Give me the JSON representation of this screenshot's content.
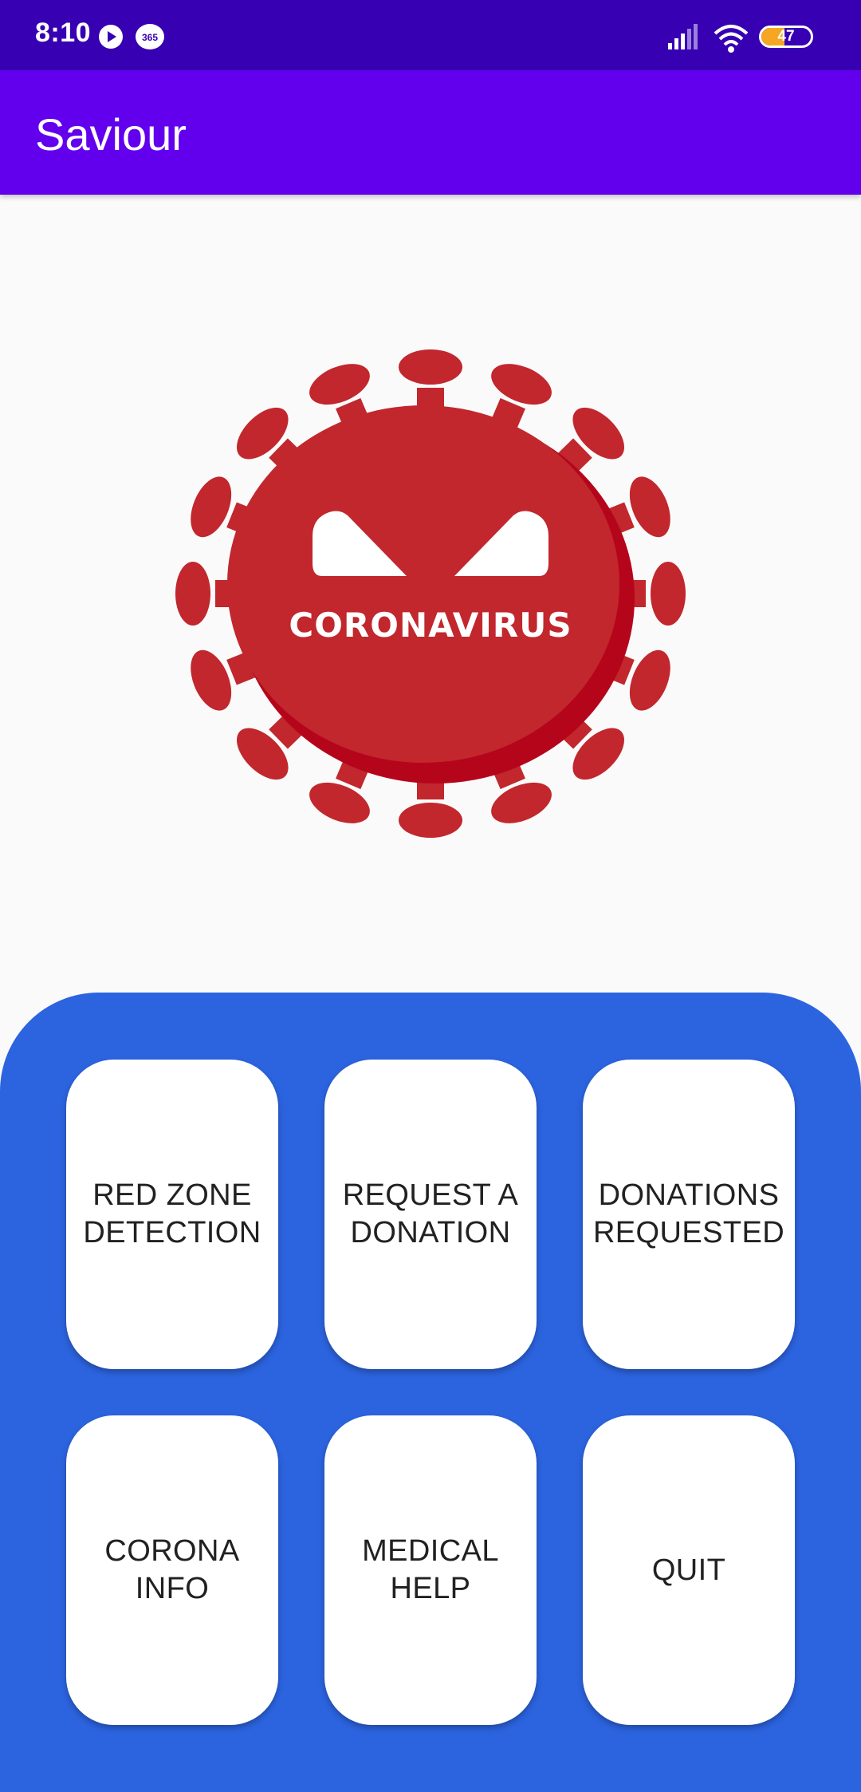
{
  "status_bar": {
    "time": "8:10",
    "icons": [
      "play-icon",
      "365-icon",
      "signal-icon",
      "wifi-icon",
      "battery-icon"
    ],
    "notification_badge": "365",
    "battery_level": "47",
    "battery_fraction": 0.47
  },
  "app_bar": {
    "title": "Saviour"
  },
  "hero": {
    "image_text": "CORONAVIRUS",
    "icon": "coronavirus-icon"
  },
  "colors": {
    "status_bar": "#3700B3",
    "app_bar": "#6200EE",
    "panel": "#2C64E0",
    "virus_red": "#C1272D",
    "card": "#FFFFFF",
    "background": "#FAFAFA"
  },
  "menu": {
    "items": [
      {
        "label": "RED ZONE\nDETECTION"
      },
      {
        "label": "REQUEST A\nDONATION"
      },
      {
        "label": "DONATIONS\nREQUESTED"
      },
      {
        "label": "CORONA\nINFO"
      },
      {
        "label": "MEDICAL\nHELP"
      },
      {
        "label": "QUIT"
      }
    ]
  }
}
